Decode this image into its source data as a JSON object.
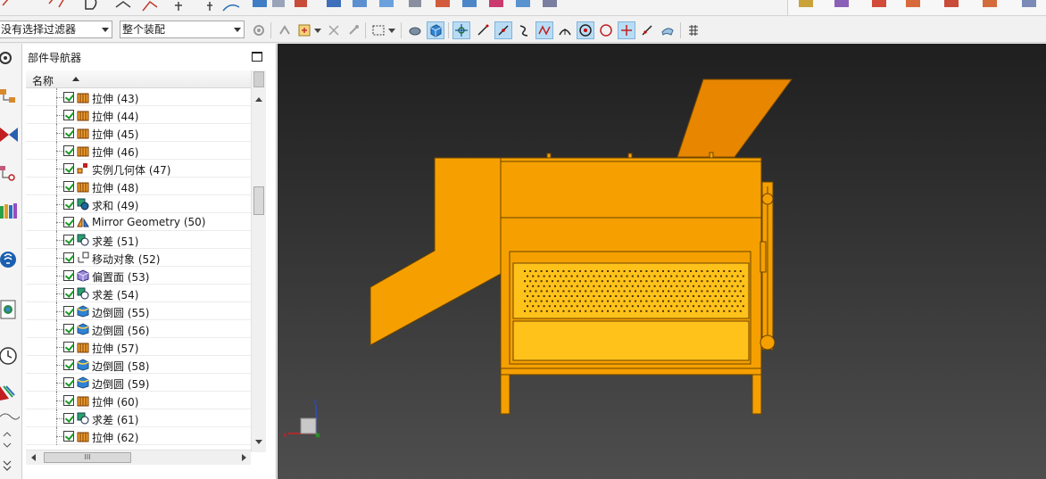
{
  "toolbar": {
    "selection_filter": "没有选择过滤器",
    "assembly_scope": "整个装配"
  },
  "navigator": {
    "title": "部件导航器",
    "column_name": "名称",
    "hscroll_thumb": "III"
  },
  "features": [
    {
      "label": "拉伸 (43)",
      "icon": "extrude-icon"
    },
    {
      "label": "拉伸 (44)",
      "icon": "extrude-icon"
    },
    {
      "label": "拉伸 (45)",
      "icon": "extrude-icon"
    },
    {
      "label": "拉伸 (46)",
      "icon": "extrude-icon"
    },
    {
      "label": "实例几何体 (47)",
      "icon": "instance-geometry-icon"
    },
    {
      "label": "拉伸 (48)",
      "icon": "extrude-icon"
    },
    {
      "label": "求和 (49)",
      "icon": "unite-icon"
    },
    {
      "label": "Mirror Geometry (50)",
      "icon": "mirror-geometry-icon"
    },
    {
      "label": "求差 (51)",
      "icon": "subtract-icon"
    },
    {
      "label": "移动对象 (52)",
      "icon": "move-object-icon"
    },
    {
      "label": "偏置面 (53)",
      "icon": "offset-face-icon"
    },
    {
      "label": "求差 (54)",
      "icon": "subtract-icon"
    },
    {
      "label": "边倒圆 (55)",
      "icon": "edge-blend-icon"
    },
    {
      "label": "边倒圆 (56)",
      "icon": "edge-blend-icon"
    },
    {
      "label": "拉伸 (57)",
      "icon": "extrude-icon"
    },
    {
      "label": "边倒圆 (58)",
      "icon": "edge-blend-icon"
    },
    {
      "label": "边倒圆 (59)",
      "icon": "edge-blend-icon"
    },
    {
      "label": "拉伸 (60)",
      "icon": "extrude-icon"
    },
    {
      "label": "求差 (61)",
      "icon": "subtract-icon"
    },
    {
      "label": "拉伸 (62)",
      "icon": "extrude-icon"
    }
  ],
  "colors": {
    "model_orange": "#f5a000",
    "model_light": "#ffc21a",
    "model_edge": "#6b4400",
    "chute_orange": "#e88600"
  }
}
